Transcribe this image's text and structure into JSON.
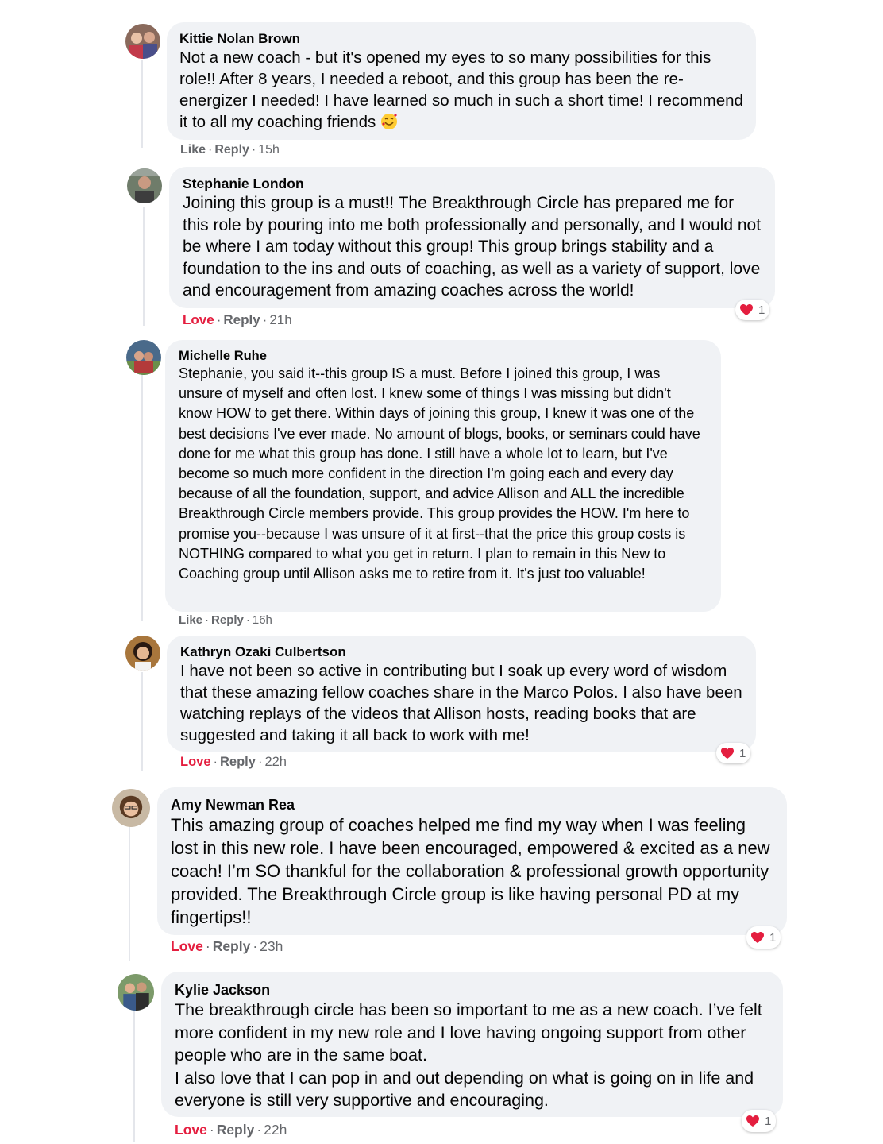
{
  "reaction_color": "#e41e3f",
  "bubble_color": "#f0f2f5",
  "comments": [
    {
      "author": "Kittie Nolan Brown",
      "text": "Not a new coach - but it's opened my eyes to so many possibilities for this role!! After 8 years, I needed a reboot, and this group has been the re-energizer I needed! I have learned so much in such a short time! I recommend it to all my coaching friends",
      "emoji": "smiling-face-with-hearts",
      "reaction_action": "Like",
      "reply": "Reply",
      "time": "15h"
    },
    {
      "author": "Stephanie London",
      "text": "Joining this group is a must!! The Breakthrough Circle has prepared me for this role by pouring into me both professionally and personally, and I would not be where I am today without this group! This group brings stability and a foundation to the ins and outs of coaching, as well as a variety of support, love and encouragement from amazing coaches across the world!",
      "reaction_action": "Love",
      "reply": "Reply",
      "time": "21h",
      "reaction_count": "1"
    },
    {
      "author": "Michelle Ruhe",
      "text": "Stephanie, you said it--this group IS a must. Before I joined this group, I was unsure of myself and often lost. I knew some of things I was missing but didn't know HOW to get there. Within days of joining this group, I knew it was one of the best decisions I've ever made. No amount of blogs, books, or seminars could have done for me what this group has done. I still have a whole lot to learn, but I've become so much more confident in the direction I'm going each and every day because of all the foundation, support, and advice Allison and ALL the incredible Breakthrough Circle members provide. This group provides the HOW. I'm here to promise you--because I was unsure of it at first--that the price this group costs is NOTHING compared to what you get in return. I plan to remain in this New to Coaching group until Allison asks me to retire from it. It's just too valuable!",
      "reaction_action": "Like",
      "reply": "Reply",
      "time": "16h"
    },
    {
      "author": "Kathryn Ozaki Culbertson",
      "text": "I have not been so active in contributing but I soak up every word of wisdom that these amazing fellow coaches share in the Marco Polos. I also have been watching replays of the videos that Allison hosts, reading books that are suggested and taking it all back to work with me!",
      "reaction_action": "Love",
      "reply": "Reply",
      "time": "22h",
      "reaction_count": "1"
    },
    {
      "author": "Amy Newman Rea",
      "text": "This amazing group of coaches helped me find my way when I was feeling lost in this new role. I have been encouraged, empowered & excited as a new coach! I’m SO thankful for the collaboration & professional growth opportunity provided. The Breakthrough Circle group is like having personal PD at my fingertips!!",
      "reaction_action": "Love",
      "reply": "Reply",
      "time": "23h",
      "reaction_count": "1"
    },
    {
      "author": "Kylie Jackson",
      "text": "The breakthrough circle has been so important to me as a new coach. I’ve felt more confident in my new role and I love having ongoing support from other people who are in the same boat.\nI also love that I can pop in and out depending on what is going on in life and everyone is still very supportive and encouraging.",
      "reaction_action": "Love",
      "reply": "Reply",
      "time": "22h",
      "reaction_count": "1"
    }
  ]
}
